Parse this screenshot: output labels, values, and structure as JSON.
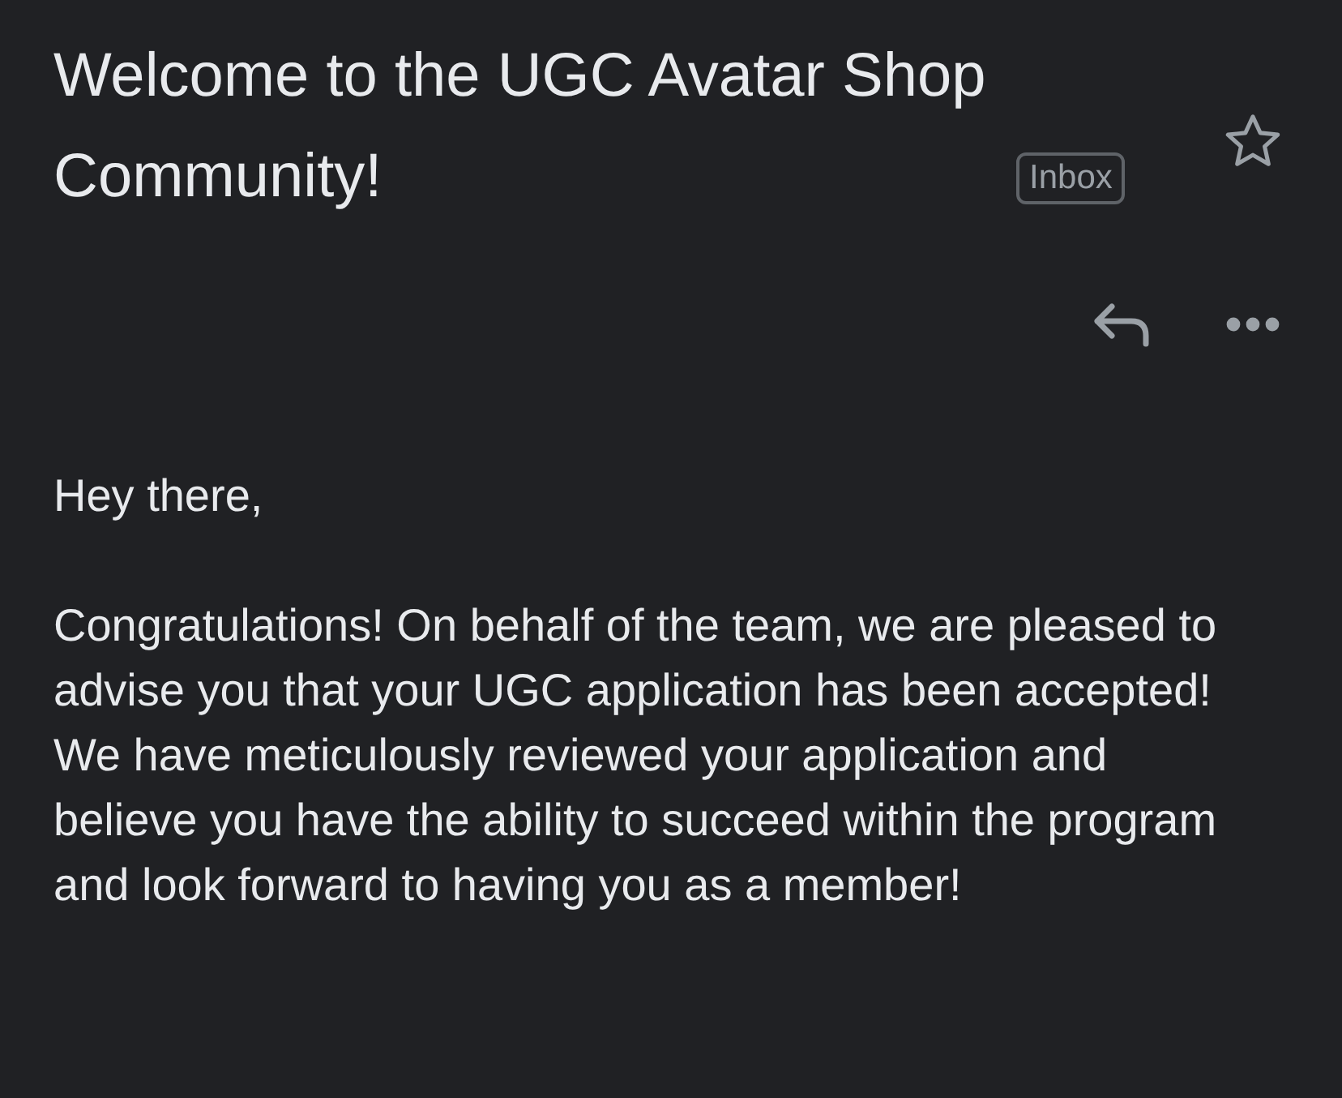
{
  "email": {
    "subject": "Welcome to the UGC Avatar Shop Community!",
    "label": "Inbox",
    "starred": false
  },
  "body": [
    "Hey there,",
    "Congratulations! On behalf of the team, we are pleased to advise you that your UGC application has been accepted! We have meticulously reviewed your application and believe you have the ability to succeed within the program and look forward to having you as a member!"
  ]
}
